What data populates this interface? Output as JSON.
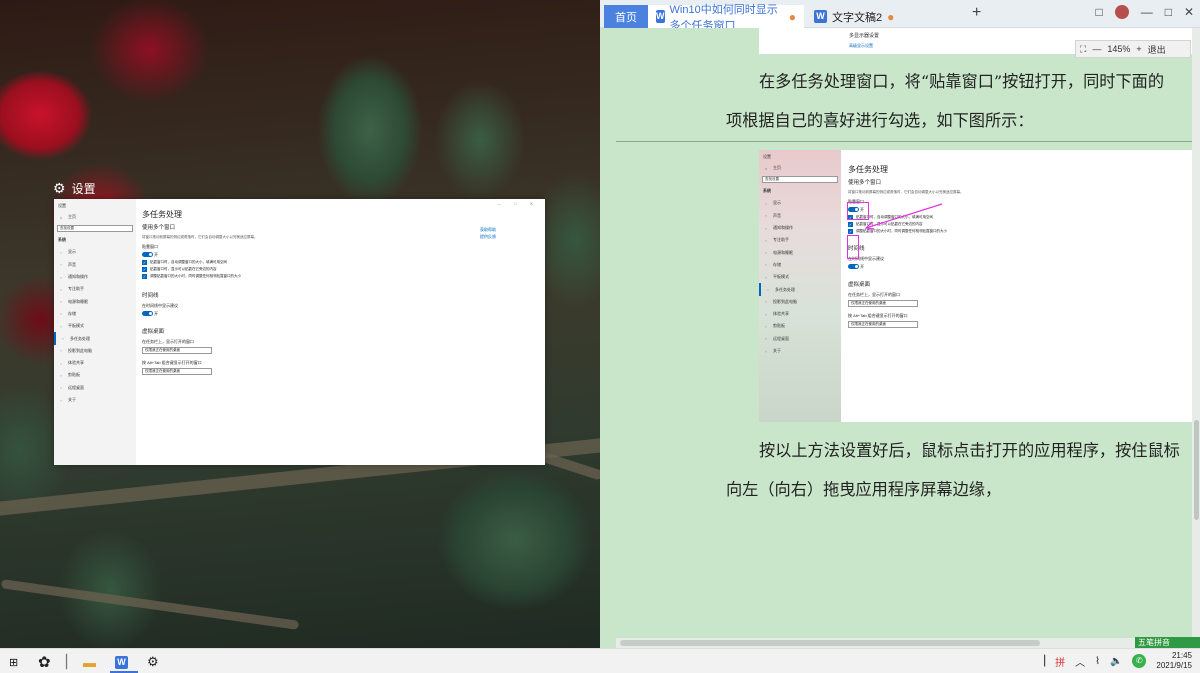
{
  "desktop": {
    "settings_label": "设置"
  },
  "settings_window": {
    "sidebar_header": "设置",
    "search_placeholder": "查找设置",
    "system_label": "系统",
    "home": "主页",
    "items": [
      {
        "icon": "display-icon",
        "label": "显示"
      },
      {
        "icon": "sound-icon",
        "label": "声音"
      },
      {
        "icon": "notification-icon",
        "label": "通知和操作"
      },
      {
        "icon": "focus-icon",
        "label": "专注助手"
      },
      {
        "icon": "power-icon",
        "label": "电源和睡眠"
      },
      {
        "icon": "storage-icon",
        "label": "存储"
      },
      {
        "icon": "tablet-icon",
        "label": "平板模式"
      },
      {
        "icon": "multitask-icon",
        "label": "多任务处理",
        "selected": true
      },
      {
        "icon": "project-icon",
        "label": "投影到此电脑"
      },
      {
        "icon": "shared-icon",
        "label": "体验共享"
      },
      {
        "icon": "clipboard-icon",
        "label": "剪贴板"
      },
      {
        "icon": "remote-icon",
        "label": "远程桌面"
      },
      {
        "icon": "info-icon",
        "label": "关于"
      }
    ],
    "title": "多任务处理",
    "section_windows": "使用多个窗口",
    "snap_desc": "将窗口拖动到屏幕的侧边或角落时，它们会自动调整大小以完美适应屏幕。",
    "snap_label": "贴靠窗口",
    "toggle_state": "开",
    "checks": [
      "贴靠窗口时，自动调整窗口的大小，填满可用空间",
      "贴靠窗口时，显示可以贴靠在它旁边的内容",
      "调整贴靠窗口的大小时，同时调整任何相邻贴靠窗口的大小"
    ],
    "section_timeline": "时间线",
    "timeline_label": "在时间线中显示建议",
    "timeline_state": "开",
    "section_desktops": "虚拟桌面",
    "taskbar_label": "在任务栏上，显示打开的窗口",
    "taskbar_value": "仅限我正在使用的桌面",
    "alttab_label": "按 Alt+Tab 组合键显示打开的窗口",
    "alttab_value": "仅限我正在使用的桌面",
    "links": [
      "获取帮助",
      "提供反馈"
    ],
    "window_controls": "— □ ✕"
  },
  "wps": {
    "tabs": {
      "home": "首页",
      "doc1": "Win10中如何同时显示多个任务窗口",
      "doc2": "文字文稿2"
    },
    "plus": "+",
    "toolbar_right": [
      "□",
      "—",
      "□",
      "✕"
    ],
    "top_snippet_title": "多显示器设置",
    "top_snippet_link": "高级显示设置",
    "zoom": {
      "fit": "⛶",
      "minus": "—",
      "value": "145%",
      "plus": "+",
      "exit": "退出"
    },
    "para1_line1": "在多任务处理窗口，将“贴靠窗口”按钮打开，同时下面的",
    "para1_line2": "项根据自己的喜好进行勾选，如下图所示：",
    "para2_line1": "按以上方法设置好后，鼠标点击打开的应用程序，按住鼠标",
    "para2_line2": "向左（向右）拖曳应用程序屏幕边缘，",
    "ime_label": "五笔拼音"
  },
  "taskbar": {
    "start": "⊞",
    "clock_time": "21:45",
    "clock_date": "2021/9/15",
    "tray": [
      "▕",
      "拼",
      "︿",
      "⌇",
      "🔈"
    ]
  },
  "colors": {
    "accent": "#0067c0",
    "wps_blue": "#3b73d8",
    "eye_protect_green": "#c9e6ca",
    "highlight_magenta": "#e033e0"
  }
}
